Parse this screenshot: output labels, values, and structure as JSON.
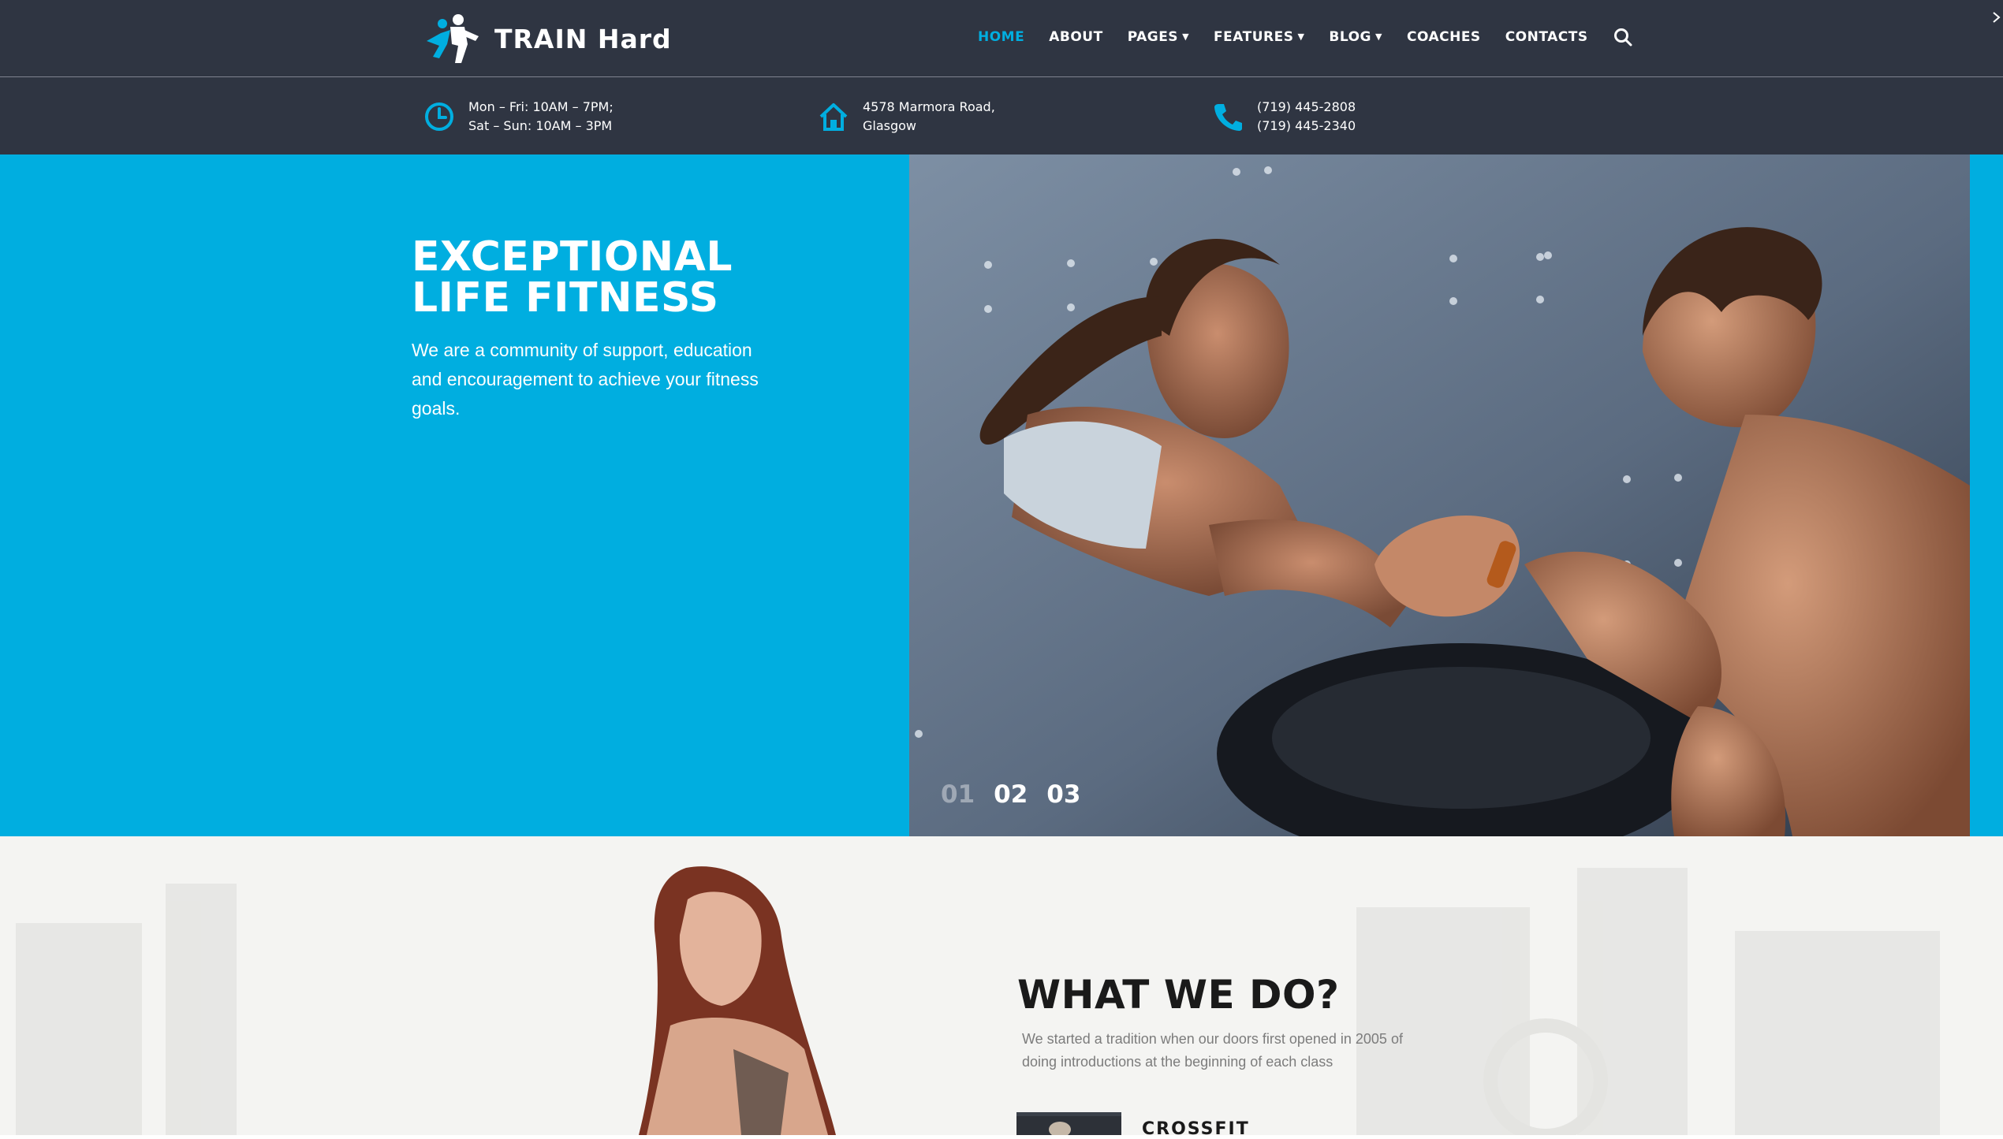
{
  "brand": {
    "name": "TRAIN Hard"
  },
  "nav": {
    "items": [
      {
        "label": "HOME",
        "active": true
      },
      {
        "label": "ABOUT"
      },
      {
        "label": "PAGES",
        "dropdown": true
      },
      {
        "label": "FEATURES",
        "dropdown": true
      },
      {
        "label": "BLOG",
        "dropdown": true
      },
      {
        "label": "COACHES"
      },
      {
        "label": "CONTACTS"
      }
    ],
    "search_icon": "search-icon"
  },
  "info": {
    "hours": {
      "line1": "Mon – Fri: 10AM – 7PM;",
      "line2": "Sat – Sun: 10AM – 3PM",
      "icon": "clock-icon"
    },
    "address": {
      "line1": "4578 Marmora Road,",
      "line2": "Glasgow",
      "icon": "home-icon"
    },
    "phone": {
      "line1": "(719) 445-2808",
      "line2": "(719) 445-2340",
      "icon": "phone-icon"
    }
  },
  "hero": {
    "title_line1": "EXCEPTIONAL",
    "title_line2": "LIFE FITNESS",
    "description": "We are a community of support, education and encouragement to achieve your fitness goals.",
    "slides": [
      "01",
      "02",
      "03"
    ],
    "active_slide_index": 0
  },
  "what_we_do": {
    "title": "WHAT WE DO?",
    "description": "We started a tradition when our doors first opened in 2005 of doing introductions at the beginning of each class",
    "first_service": "CROSSFIT"
  },
  "colors": {
    "accent": "#00aee0",
    "dark": "#2f3542",
    "text_dark": "#1a1a1a",
    "muted": "#7c7c7c"
  }
}
